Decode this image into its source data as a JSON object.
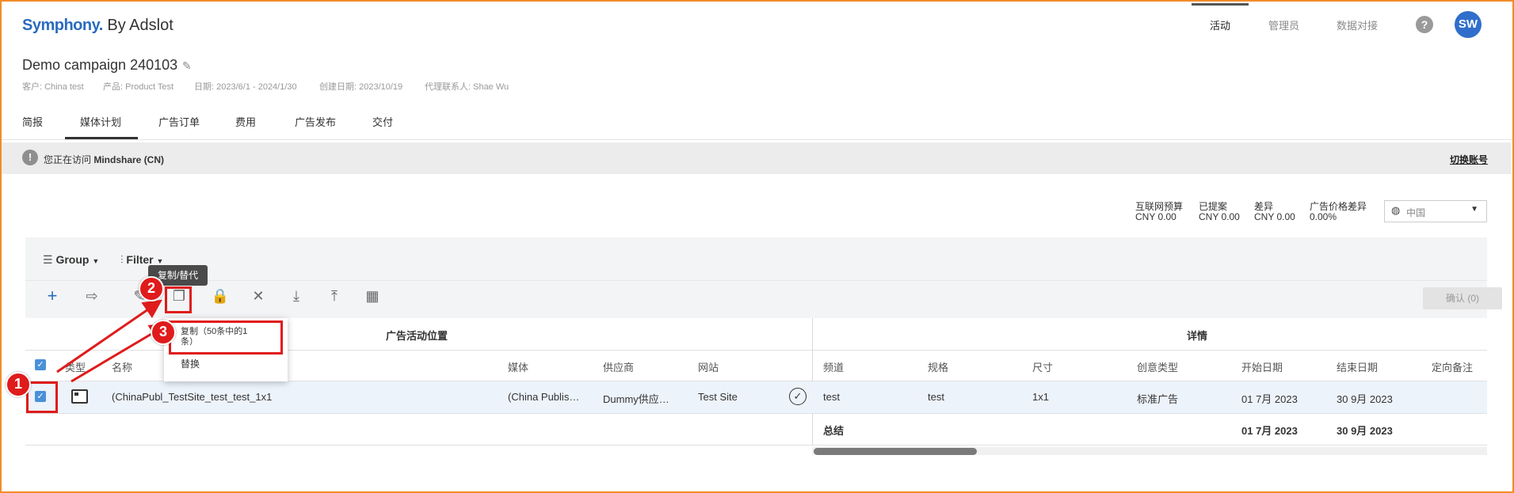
{
  "header": {
    "brand": "Symphony.",
    "brand_suffix": " By Adslot",
    "nav": [
      "活动",
      "管理员",
      "数据对接"
    ],
    "help": "?",
    "avatar": "SW"
  },
  "campaign": {
    "title": "Demo campaign 240103",
    "meta": [
      "客户: China test",
      "产品: Product Test",
      "日期: 2023/6/1 - 2024/1/30",
      "创建日期: 2023/10/19",
      "代理联系人: Shae Wu"
    ]
  },
  "tabs": [
    "简报",
    "媒体计划",
    "广告订单",
    "费用",
    "广告发布",
    "交付"
  ],
  "notice": {
    "icon": "!",
    "prefix": "您正在访问 ",
    "account": "Mindshare (CN)",
    "switch_label": "切换账号"
  },
  "summary": [
    {
      "label": "互联网预算",
      "value": "CNY 0.00"
    },
    {
      "label": "已提案",
      "value": "CNY 0.00"
    },
    {
      "label": "差异",
      "value": "CNY 0.00"
    },
    {
      "label": "广告价格差异",
      "value": "0.00%"
    }
  ],
  "country_select": {
    "value": "中国"
  },
  "toolbar": {
    "group_label": "Group",
    "filter_label": "Filter",
    "confirm_label": "确认 (0)",
    "tooltip": "复制/替代"
  },
  "dropdown": {
    "copy": "复制（50条中的1条）",
    "replace": "替换"
  },
  "table": {
    "group_left": "广告活动位置",
    "group_right": "详情",
    "columns_left": [
      "类型",
      "名称",
      "媒体",
      "供应商",
      "网站"
    ],
    "columns_right": [
      "频道",
      "规格",
      "尺寸",
      "创意类型",
      "开始日期",
      "结束日期",
      "定向备注"
    ],
    "row": {
      "name": "(ChinaPubl_TestSite_test_test_1x1",
      "media": "(China Publis…",
      "supplier": "Dummy供应…",
      "site": "Test Site",
      "channel": "test",
      "spec": "test",
      "size": "1x1",
      "creative": "标准广告",
      "start": "01 7月 2023",
      "end": "30 9月 2023"
    },
    "total": {
      "label": "总结",
      "start": "01 7月 2023",
      "end": "30 9月 2023"
    }
  },
  "annotations": [
    "1",
    "2",
    "3"
  ],
  "colors": {
    "brand": "#2a6bbf",
    "accent": "#4a90d9",
    "annotation": "#e01b1b",
    "frame": "#f28c28"
  }
}
